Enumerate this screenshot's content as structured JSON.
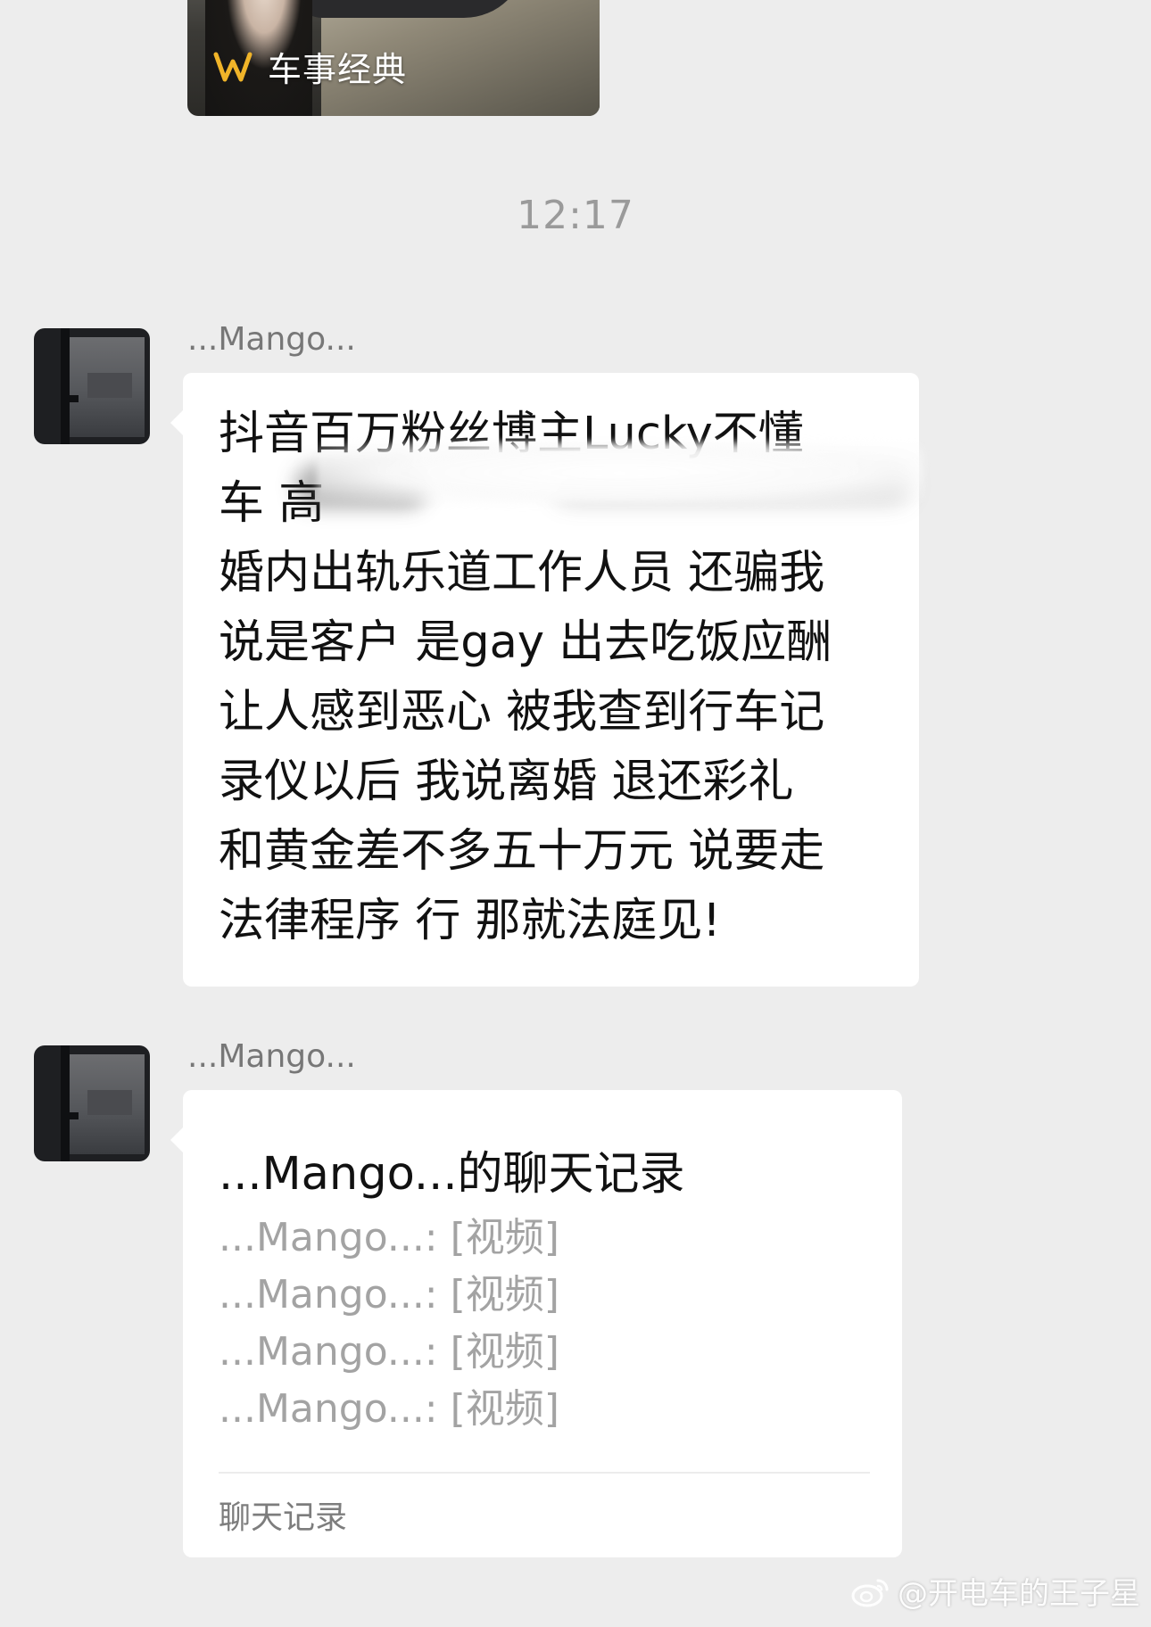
{
  "video_card": {
    "brand_name": "车事经典",
    "brand_logo_icon": "brand-logo-icon"
  },
  "timestamp": "12:17",
  "messages": [
    {
      "sender": "...Mango...",
      "lines": [
        "抖音百万粉丝博主Lucky不懂",
        "车 高",
        "婚内出轨乐道工作人员 还骗我",
        "说是客户 是gay 出去吃饭应酬",
        "让人感到恶心 被我查到行车记",
        "录仪以后 我说离婚 退还彩礼",
        "和黄金差不多五十万元 说要走",
        "法律程序 行 那就法庭见!"
      ]
    },
    {
      "sender": "...Mango...",
      "chat_record": {
        "title": "...Mango...的聊天记录",
        "entries": [
          "...Mango...: [视频]",
          "...Mango...: [视频]",
          "...Mango...: [视频]",
          "...Mango...: [视频]"
        ],
        "footer": "聊天记录"
      }
    }
  ],
  "watermark": {
    "text": "@开电车的王子星",
    "icon": "weibo-icon"
  }
}
